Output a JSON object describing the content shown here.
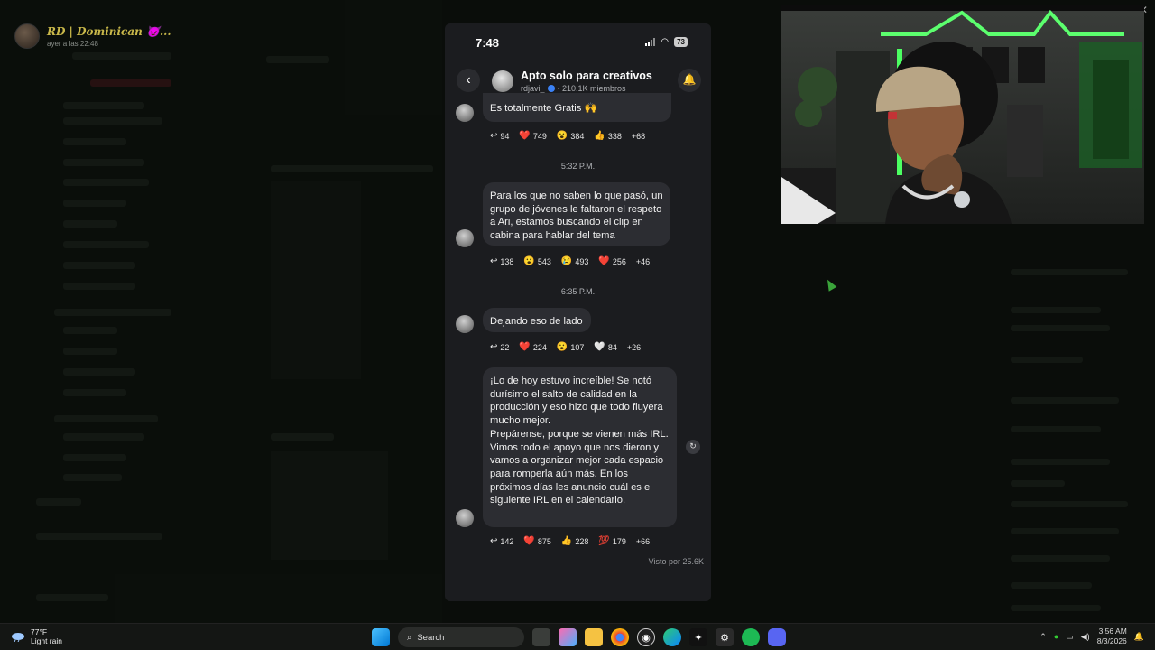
{
  "background": {
    "top_user_name": "RD | Dominican 😈...",
    "top_user_time": "ayer a las 22:48"
  },
  "phone": {
    "status_time": "7:48",
    "battery": "73",
    "channel_title": "Apto solo para creativos",
    "channel_handle": "rdjavi_",
    "channel_members": "· 210.1K miembros",
    "messages": [
      {
        "text": "Es totalmente Gratis 🙌",
        "reactions": [
          {
            "emoji": "↩",
            "count": "94"
          },
          {
            "emoji": "❤️",
            "count": "749"
          },
          {
            "emoji": "😮",
            "count": "384"
          },
          {
            "emoji": "👍",
            "count": "338"
          },
          {
            "emoji": "",
            "count": "+68"
          }
        ]
      },
      {
        "time": "5:32 P.M.",
        "text": "Para los que no saben lo que pasó, un grupo de jóvenes le faltaron el respeto a Ari, estamos buscando el clip en cabina para hablar del tema",
        "reactions": [
          {
            "emoji": "↩",
            "count": "138"
          },
          {
            "emoji": "😮",
            "count": "543"
          },
          {
            "emoji": "😢",
            "count": "493"
          },
          {
            "emoji": "❤️",
            "count": "256"
          },
          {
            "emoji": "",
            "count": "+46"
          }
        ]
      },
      {
        "time": "6:35 P.M.",
        "text": "Dejando eso de lado",
        "reactions": [
          {
            "emoji": "↩",
            "count": "22"
          },
          {
            "emoji": "❤️",
            "count": "224"
          },
          {
            "emoji": "😮",
            "count": "107"
          },
          {
            "emoji": "🤍",
            "count": "84"
          },
          {
            "emoji": "",
            "count": "+26"
          }
        ]
      },
      {
        "text_p1": "¡Lo de hoy estuvo increíble! Se notó durísimo el salto de calidad en la producción y eso hizo que todo fluyera mucho mejor.",
        "text_p2": "Prepárense, porque se vienen más IRL. Vimos todo el apoyo que nos dieron y vamos a organizar mejor cada espacio para romperla aún más. En los próximos días les anuncio cuál es el siguiente IRL en el calendario.",
        "reactions": [
          {
            "emoji": "↩",
            "count": "142"
          },
          {
            "emoji": "❤️",
            "count": "875"
          },
          {
            "emoji": "👍",
            "count": "228"
          },
          {
            "emoji": "💯",
            "count": "179"
          },
          {
            "emoji": "",
            "count": "+66"
          }
        ]
      }
    ],
    "seen_by": "Visto por 25.6K"
  },
  "taskbar": {
    "weather_temp": "77°F",
    "weather_desc": "Light rain",
    "search_label": "Search",
    "time": "3:56 AM",
    "date": "8/3/2026"
  }
}
